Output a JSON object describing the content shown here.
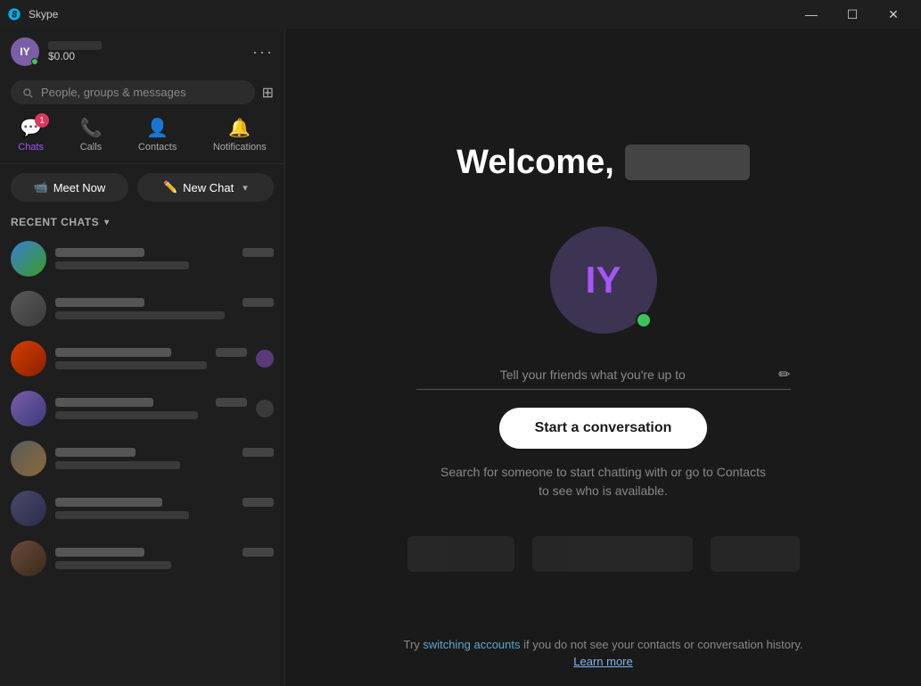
{
  "titleBar": {
    "appName": "Skype",
    "controls": {
      "minimize": "—",
      "maximize": "☐",
      "close": "✕"
    }
  },
  "sidebar": {
    "profile": {
      "initials": "IY",
      "namePlaceholder": "",
      "credit": "$0.00"
    },
    "search": {
      "placeholder": "People, groups & messages"
    },
    "navTabs": [
      {
        "id": "chats",
        "label": "Chats",
        "badge": "1",
        "active": true
      },
      {
        "id": "calls",
        "label": "Calls",
        "badge": null,
        "active": false
      },
      {
        "id": "contacts",
        "label": "Contacts",
        "badge": null,
        "active": false
      },
      {
        "id": "notifications",
        "label": "Notifications",
        "badge": null,
        "active": false
      }
    ],
    "actionButtons": {
      "meetNow": "Meet Now",
      "newChat": "New Chat"
    },
    "recentChats": {
      "header": "RECENT CHATS",
      "items": [
        {
          "id": 1,
          "avatarClass": "a1"
        },
        {
          "id": 2,
          "avatarClass": "a2"
        },
        {
          "id": 3,
          "avatarClass": "a3"
        },
        {
          "id": 4,
          "avatarClass": "a4"
        },
        {
          "id": 5,
          "avatarClass": "a5"
        },
        {
          "id": 6,
          "avatarClass": "a6"
        },
        {
          "id": 7,
          "avatarClass": "a7"
        }
      ]
    }
  },
  "mainContent": {
    "welcomeText": "Welcome,",
    "avatarInitials": "IY",
    "statusPlaceholder": "Tell your friends what you're up to",
    "startConversationBtn": "Start a conversation",
    "searchHint": "Search for someone to start chatting with or go to Contacts to see who is available.",
    "footer": {
      "prefix": "Try ",
      "switchingAccountsLink": "switching accounts",
      "suffix": " if you do not see your contacts or conversation history.",
      "learnMore": "Learn more"
    }
  }
}
